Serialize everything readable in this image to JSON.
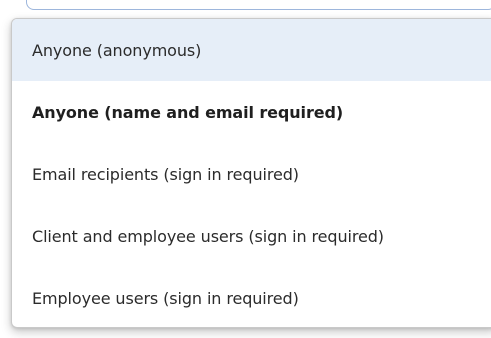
{
  "dropdown": {
    "options": [
      {
        "label": "Anyone (anonymous)",
        "state": "highlighted"
      },
      {
        "label": "Anyone (name and email required)",
        "state": "selected"
      },
      {
        "label": "Email recipients (sign in required)",
        "state": "normal"
      },
      {
        "label": "Client and employee users (sign in required)",
        "state": "normal"
      },
      {
        "label": "Employee users (sign in required)",
        "state": "normal"
      }
    ]
  },
  "colors": {
    "highlight_bg": "#e6eef8",
    "select_border": "#9db6dc",
    "text": "#2b2b2b"
  }
}
